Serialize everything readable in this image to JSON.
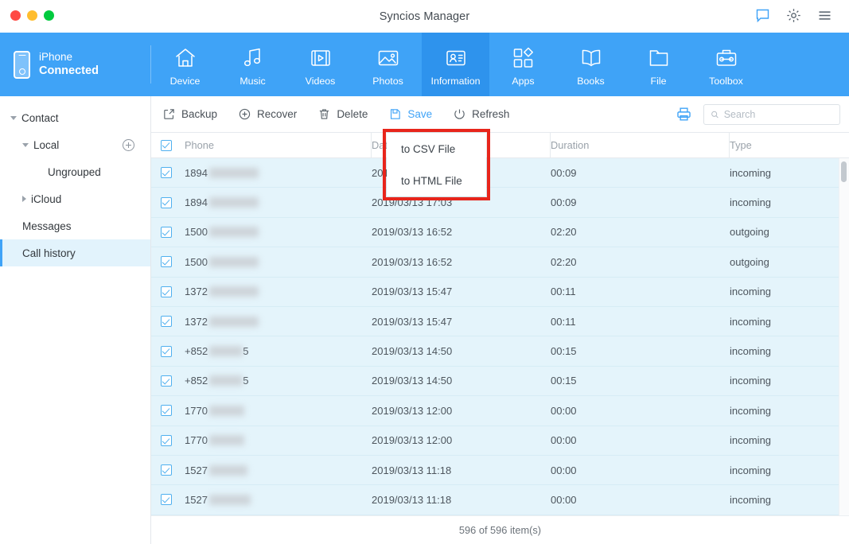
{
  "window": {
    "title": "Syncios Manager",
    "traffic_lights": [
      "close",
      "minimize",
      "maximize"
    ],
    "title_icons": [
      "feedback-icon",
      "gear-icon",
      "menu-icon"
    ]
  },
  "device": {
    "name": "iPhone",
    "status": "Connected",
    "icon": "iphone-icon"
  },
  "nav": {
    "items": [
      {
        "label": "Device",
        "icon": "home-icon",
        "active": false
      },
      {
        "label": "Music",
        "icon": "music-note-icon",
        "active": false
      },
      {
        "label": "Videos",
        "icon": "video-film-icon",
        "active": false
      },
      {
        "label": "Photos",
        "icon": "photo-icon",
        "active": false
      },
      {
        "label": "Information",
        "icon": "contact-card-icon",
        "active": true
      },
      {
        "label": "Apps",
        "icon": "apps-grid-icon",
        "active": false
      },
      {
        "label": "Books",
        "icon": "book-icon",
        "active": false
      },
      {
        "label": "File",
        "icon": "folder-icon",
        "active": false
      },
      {
        "label": "Toolbox",
        "icon": "toolbox-icon",
        "active": false
      }
    ]
  },
  "sidebar": {
    "items": [
      {
        "label": "Contact",
        "level": 0,
        "caret": "down",
        "selected": false,
        "add_button": false
      },
      {
        "label": "Local",
        "level": 1,
        "caret": "down",
        "selected": false,
        "add_button": true
      },
      {
        "label": "Ungrouped",
        "level": 2,
        "caret": "none",
        "selected": false,
        "add_button": false
      },
      {
        "label": "iCloud",
        "level": 1,
        "caret": "right",
        "selected": false,
        "add_button": false
      },
      {
        "label": "Messages",
        "level": 0,
        "caret": "none",
        "selected": false,
        "add_button": false
      },
      {
        "label": "Call history",
        "level": 0,
        "caret": "none",
        "selected": true,
        "add_button": false
      }
    ]
  },
  "toolbar": {
    "buttons": [
      {
        "label": "Backup",
        "icon": "export-box-icon"
      },
      {
        "label": "Recover",
        "icon": "plus-circle-icon"
      },
      {
        "label": "Delete",
        "icon": "trash-icon"
      },
      {
        "label": "Save",
        "icon": "save-disk-icon"
      },
      {
        "label": "Refresh",
        "icon": "refresh-icon"
      }
    ],
    "print_icon": "printer-icon",
    "search_placeholder": "Search",
    "search_value": "",
    "search_icon": "search-icon"
  },
  "save_menu": {
    "visible": true,
    "highlight_color": "#e8251b",
    "items": [
      {
        "label": "to CSV File"
      },
      {
        "label": "to HTML File"
      }
    ]
  },
  "table": {
    "columns": [
      "Phone",
      "Date",
      "Duration",
      "Type"
    ],
    "header_checkbox_checked": true,
    "rows": [
      {
        "checked": true,
        "phone_prefix": "1894",
        "phone_suffix": "",
        "blur_width": 62,
        "date": "2019/03/13 17:03",
        "duration": "00:09",
        "type": "incoming"
      },
      {
        "checked": true,
        "phone_prefix": "1894",
        "phone_suffix": "",
        "blur_width": 62,
        "date": "2019/03/13 17:03",
        "duration": "00:09",
        "type": "incoming"
      },
      {
        "checked": true,
        "phone_prefix": "1500",
        "phone_suffix": "",
        "blur_width": 62,
        "date": "2019/03/13 16:52",
        "duration": "02:20",
        "type": "outgoing"
      },
      {
        "checked": true,
        "phone_prefix": "1500",
        "phone_suffix": "",
        "blur_width": 62,
        "date": "2019/03/13 16:52",
        "duration": "02:20",
        "type": "outgoing"
      },
      {
        "checked": true,
        "phone_prefix": "1372",
        "phone_suffix": "",
        "blur_width": 62,
        "date": "2019/03/13 15:47",
        "duration": "00:11",
        "type": "incoming"
      },
      {
        "checked": true,
        "phone_prefix": "1372",
        "phone_suffix": "",
        "blur_width": 62,
        "date": "2019/03/13 15:47",
        "duration": "00:11",
        "type": "incoming"
      },
      {
        "checked": true,
        "phone_prefix": "+852",
        "phone_suffix": "5",
        "blur_width": 42,
        "date": "2019/03/13 14:50",
        "duration": "00:15",
        "type": "incoming"
      },
      {
        "checked": true,
        "phone_prefix": "+852",
        "phone_suffix": "5",
        "blur_width": 42,
        "date": "2019/03/13 14:50",
        "duration": "00:15",
        "type": "incoming"
      },
      {
        "checked": true,
        "phone_prefix": "1770",
        "phone_suffix": "",
        "blur_width": 44,
        "date": "2019/03/13 12:00",
        "duration": "00:00",
        "type": "incoming"
      },
      {
        "checked": true,
        "phone_prefix": "1770",
        "phone_suffix": "",
        "blur_width": 44,
        "date": "2019/03/13 12:00",
        "duration": "00:00",
        "type": "incoming"
      },
      {
        "checked": true,
        "phone_prefix": "1527",
        "phone_suffix": "",
        "blur_width": 48,
        "date": "2019/03/13 11:18",
        "duration": "00:00",
        "type": "incoming"
      },
      {
        "checked": true,
        "phone_prefix": "1527",
        "phone_suffix": "",
        "blur_width": 52,
        "date": "2019/03/13 11:18",
        "duration": "00:00",
        "type": "incoming"
      }
    ]
  },
  "footer": {
    "count_text": "596 of 596 item(s)"
  },
  "colors": {
    "accent_blue": "#3fa3f7",
    "nav_active": "#2e93ed",
    "row_selected": "#e4f4fb",
    "highlight_red": "#e8251b"
  }
}
